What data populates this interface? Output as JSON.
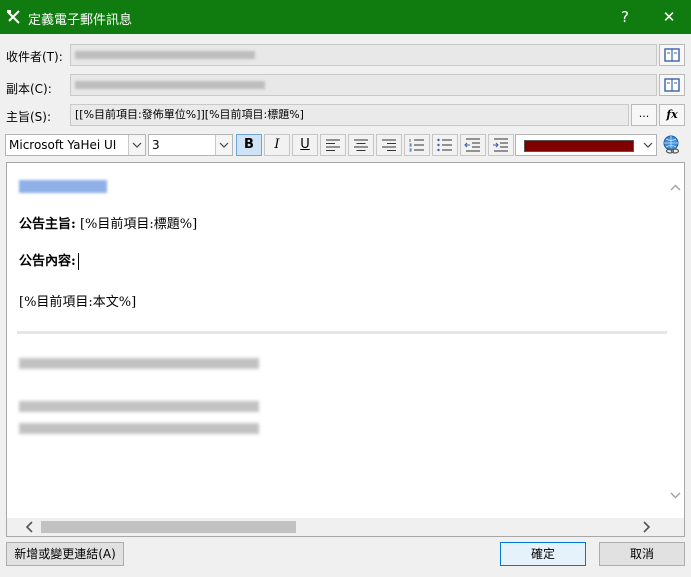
{
  "window": {
    "title": "定義電子郵件訊息",
    "help_label": "?",
    "close_label": "✕"
  },
  "fields": {
    "to_label": "收件者(T):",
    "cc_label": "副本(C):",
    "subject_label": "主旨(S):",
    "subject_value": "[[%目前項目:發佈單位%]][%目前項目:標題%]",
    "subject_more_label": "...",
    "formula_label": "fx"
  },
  "toolbar": {
    "font_name": "Microsoft YaHei UI",
    "font_size": "3",
    "bold_label": "B",
    "italic_label": "I",
    "underline_label": "U",
    "text_color": "#800000"
  },
  "body": {
    "subject_heading": "公告主旨:",
    "subject_field": "[%目前項目:標題%]",
    "content_heading": "公告內容:",
    "content_field": "[%目前項目:本文%]"
  },
  "footer": {
    "add_link_label": "新增或變更連結(A)",
    "ok_label": "確定",
    "cancel_label": "取消"
  },
  "colors": {
    "title_bar": "#107c10",
    "window_bg": "#f0f0f0",
    "link_blue": "#3c78d8"
  },
  "icons": {
    "app": "tools-icon",
    "address_book": "address-book-icon",
    "formula": "function-icon",
    "hyperlink": "hyperlink-icon"
  }
}
